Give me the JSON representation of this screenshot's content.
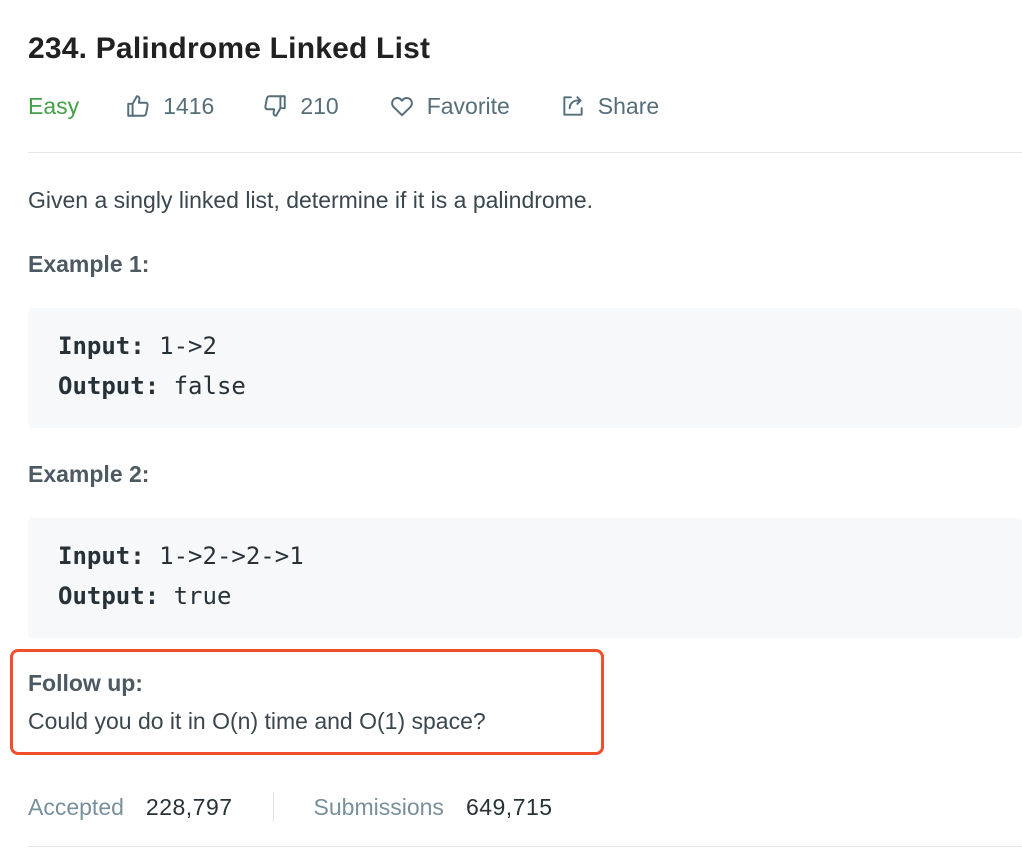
{
  "problem": {
    "title": "234. Palindrome Linked List",
    "difficulty": "Easy",
    "likes": "1416",
    "dislikes": "210",
    "favorite_label": "Favorite",
    "share_label": "Share",
    "description": "Given a singly linked list, determine if it is a palindrome."
  },
  "examples": [
    {
      "label": "Example 1:",
      "input_key": "Input:",
      "input_value": " 1->2",
      "output_key": "Output:",
      "output_value": " false"
    },
    {
      "label": "Example 2:",
      "input_key": "Input:",
      "input_value": " 1->2->2->1",
      "output_key": "Output:",
      "output_value": " true"
    }
  ],
  "follow_up": {
    "title": "Follow up:",
    "text": "Could you do it in O(n) time and O(1) space?"
  },
  "stats": {
    "accepted_label": "Accepted",
    "accepted_value": "228,797",
    "submissions_label": "Submissions",
    "submissions_value": "649,715"
  },
  "colors": {
    "difficulty_easy": "#43a047",
    "highlight_border": "#f24e2c",
    "code_background": "#f6f8fa"
  },
  "icons": {
    "likes": "thumbs-up-icon",
    "dislikes": "thumbs-down-icon",
    "favorite": "heart-icon",
    "share": "share-icon"
  }
}
